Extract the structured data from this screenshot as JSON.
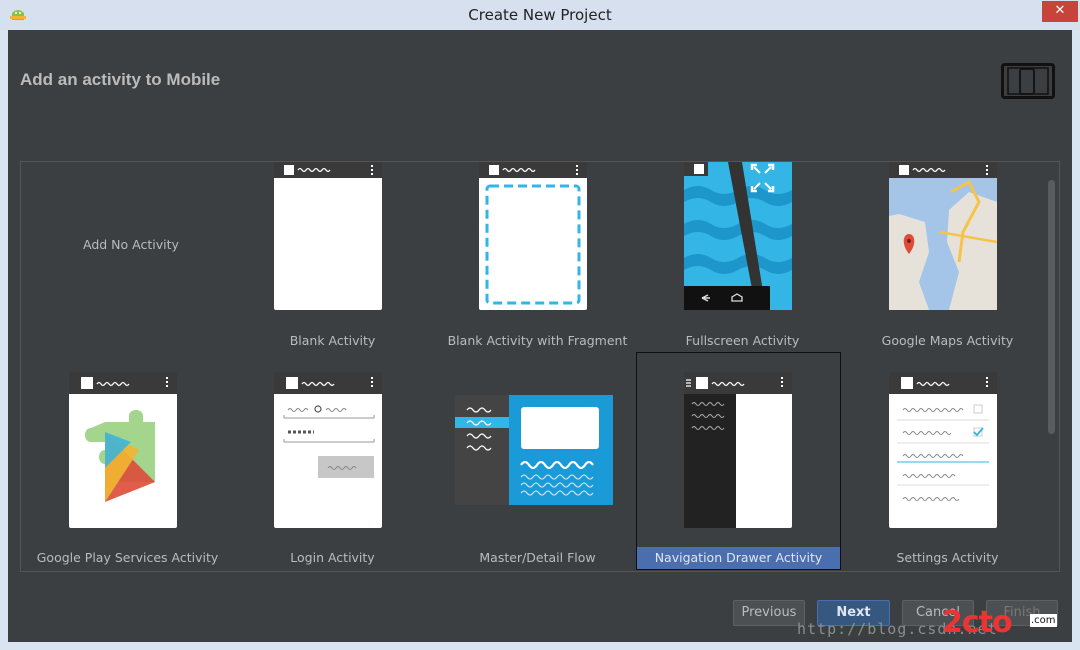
{
  "window": {
    "title": "Create New Project",
    "close_glyph": "✕"
  },
  "header": {
    "title": "Add an activity to Mobile"
  },
  "gallery": {
    "no_activity": "Add No Activity",
    "tiles": [
      {
        "label": "Blank Activity"
      },
      {
        "label": "Blank Activity with Fragment"
      },
      {
        "label": "Fullscreen Activity"
      },
      {
        "label": "Google Maps Activity"
      },
      {
        "label": "Google Play Services Activity"
      },
      {
        "label": "Login Activity"
      },
      {
        "label": "Master/Detail Flow"
      },
      {
        "label": "Navigation Drawer Activity",
        "selected": true
      },
      {
        "label": "Settings Activity"
      }
    ]
  },
  "footer": {
    "previous": "Previous",
    "next": "Next",
    "cancel": "Cancel",
    "finish": "Finish"
  },
  "watermark": {
    "url": "http://blog.csdn.net",
    "logo": "2cto",
    "sub": ".com"
  },
  "colors": {
    "background": "#3c3f41",
    "selection": "#4b6eaf",
    "text": "#bbbbbb"
  }
}
